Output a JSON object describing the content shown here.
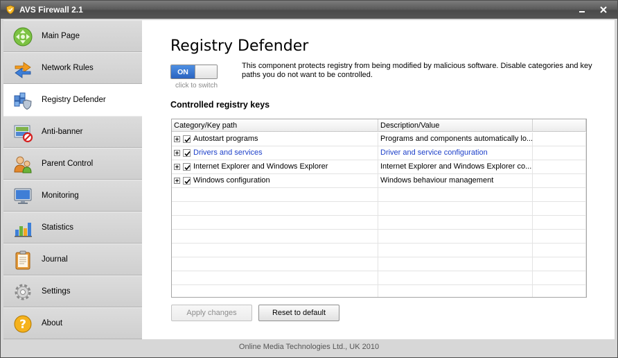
{
  "window": {
    "title": "AVS Firewall 2.1",
    "accent_color": "#2a63bf"
  },
  "sidebar": {
    "items": [
      {
        "label": "Main Page",
        "icon": "main-page-icon"
      },
      {
        "label": "Network Rules",
        "icon": "network-rules-icon"
      },
      {
        "label": "Registry Defender",
        "icon": "registry-defender-icon",
        "active": true
      },
      {
        "label": "Anti-banner",
        "icon": "anti-banner-icon"
      },
      {
        "label": "Parent Control",
        "icon": "parent-control-icon"
      },
      {
        "label": "Monitoring",
        "icon": "monitor-icon"
      },
      {
        "label": "Statistics",
        "icon": "statistics-icon"
      },
      {
        "label": "Journal",
        "icon": "journal-icon"
      },
      {
        "label": "Settings",
        "icon": "settings-icon"
      },
      {
        "label": "About",
        "icon": "about-icon"
      }
    ]
  },
  "main": {
    "title": "Registry Defender",
    "toggle": {
      "state": "ON",
      "hint": "click to switch"
    },
    "description": "This component protects registry from being modified by malicious software. Disable categories and key paths you do not want to be controlled.",
    "section_heading": "Controlled registry keys",
    "table": {
      "columns": [
        "Category/Key path",
        "Description/Value"
      ],
      "rows": [
        {
          "key": "Autostart programs",
          "description": "Programs and components automatically lo...",
          "checked": true
        },
        {
          "key": "Drivers and services",
          "description": "Driver and service configuration",
          "checked": true,
          "highlighted": true
        },
        {
          "key": "Internet Explorer and Windows Explorer",
          "description": "Internet Explorer and Windows Explorer co...",
          "checked": true
        },
        {
          "key": "Windows configuration",
          "description": "Windows behaviour management",
          "checked": true
        }
      ]
    },
    "buttons": {
      "apply": "Apply changes",
      "reset": "Reset to default"
    }
  },
  "footer": {
    "text": "Online Media Technologies Ltd., UK 2010"
  }
}
